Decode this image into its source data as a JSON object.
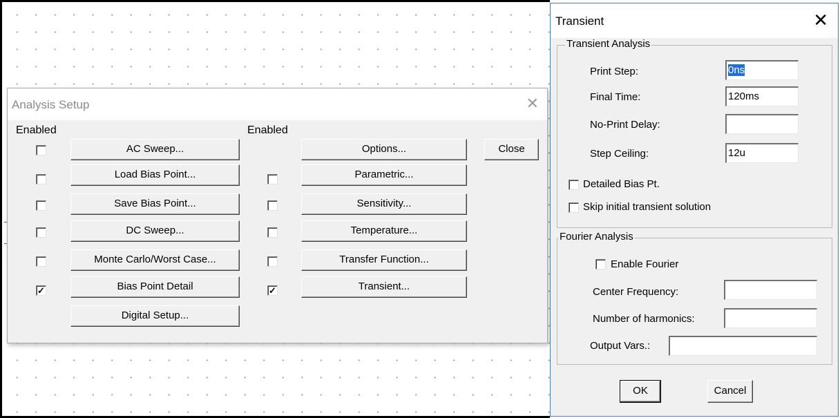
{
  "analysis_setup": {
    "title": "Analysis Setup",
    "enabled_header_left": "Enabled",
    "enabled_header_right": "Enabled",
    "close_label": "Close",
    "left_buttons": [
      {
        "label": "AC Sweep...",
        "checked": false,
        "has_checkbox": true
      },
      {
        "label": "Load Bias Point...",
        "checked": false,
        "has_checkbox": true
      },
      {
        "label": "Save Bias Point...",
        "checked": false,
        "has_checkbox": true
      },
      {
        "label": "DC Sweep...",
        "checked": false,
        "has_checkbox": true
      },
      {
        "label": "Monte Carlo/Worst Case...",
        "checked": false,
        "has_checkbox": true
      },
      {
        "label": "Bias Point Detail",
        "checked": true,
        "has_checkbox": true
      },
      {
        "label": "Digital Setup...",
        "checked": false,
        "has_checkbox": false
      }
    ],
    "right_buttons": [
      {
        "label": "Options...",
        "checked": false,
        "has_checkbox": false
      },
      {
        "label": "Parametric...",
        "checked": false,
        "has_checkbox": true
      },
      {
        "label": "Sensitivity...",
        "checked": false,
        "has_checkbox": true
      },
      {
        "label": "Temperature...",
        "checked": false,
        "has_checkbox": true
      },
      {
        "label": "Transfer Function...",
        "checked": false,
        "has_checkbox": true
      },
      {
        "label": "Transient...",
        "checked": true,
        "has_checkbox": true
      }
    ]
  },
  "transient": {
    "title": "Transient",
    "transient_group": "Transient Analysis",
    "print_step_label": "Print Step:",
    "print_step_value": "0ns",
    "final_time_label": "Final Time:",
    "final_time_value": "120ms",
    "no_print_delay_label": "No-Print Delay:",
    "no_print_delay_value": "",
    "step_ceiling_label": "Step Ceiling:",
    "step_ceiling_value": "12u",
    "detailed_bias_label": "Detailed Bias Pt.",
    "skip_initial_label": "Skip initial transient solution",
    "fourier_group": "Fourier Analysis",
    "enable_fourier_label": "Enable Fourier",
    "center_freq_label": "Center Frequency:",
    "center_freq_value": "",
    "num_harmonics_label": "Number of harmonics:",
    "num_harmonics_value": "",
    "output_vars_label": "Output Vars.:",
    "output_vars_value": "",
    "ok_label": "OK",
    "cancel_label": "Cancel"
  },
  "colors": {
    "selection": "#1f6fd6",
    "dialog_bg": "#f0f0f0",
    "active_border": "#3e7fcf"
  }
}
